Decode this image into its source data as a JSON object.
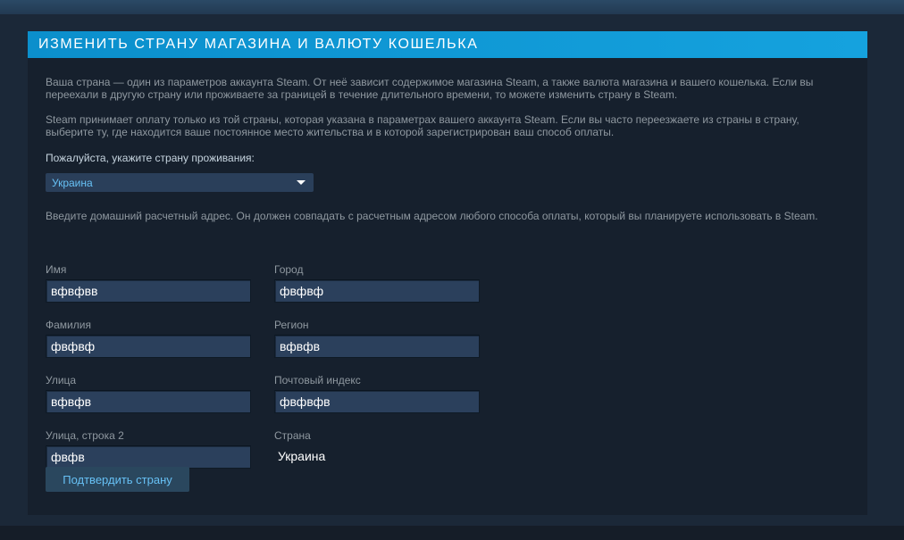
{
  "panel": {
    "title": "Изменить страну магазина и валюту кошелька",
    "intro_paragraph": "Ваша страна — один из параметров аккаунта Steam. От неё зависит содержимое магазина Steam, а также валюта магазина и вашего кошелька. Если вы переехали в другую страну или проживаете за границей в течение длительного времени, то можете изменить страну в Steam.",
    "payment_paragraph": "Steam принимает оплату только из той страны, которая указана в параметрах вашего аккаунта Steam. Если вы часто переезжаете из страны в страну, выберите ту, где находится ваше постоянное место жительства и в которой зарегистрирован ваш способ оплаты.",
    "country_prompt": "Пожалуйста, укажите страну проживания:",
    "country_select_value": "Украина",
    "address_note": "Введите домашний расчетный адрес. Он должен совпадать с расчетным адресом любого способа оплаты, который вы планируете использовать в Steam."
  },
  "form": {
    "first_name": {
      "label": "Имя",
      "value": "вфвфвв"
    },
    "last_name": {
      "label": "Фамилия",
      "value": "фвфвф"
    },
    "street": {
      "label": "Улица",
      "value": "вфвфв"
    },
    "street2": {
      "label": "Улица, строка 2",
      "value": "фвфв"
    },
    "city": {
      "label": "Город",
      "value": "фвфвф"
    },
    "region": {
      "label": "Регион",
      "value": "вфвфв"
    },
    "postal_code": {
      "label": "Почтовый индекс",
      "value": "фвфвфв"
    },
    "country": {
      "label": "Страна",
      "value": "Украина"
    }
  },
  "actions": {
    "confirm_label": "Подтвердить страну"
  },
  "colors": {
    "header_accent": "#0d9bd3",
    "link_blue": "#67c1f5",
    "background": "#1b2838",
    "panel": "#16202d",
    "input_bg": "#2b405c",
    "button_bg": "#2a475e"
  },
  "icons": {
    "select_caret": "chevron-down-icon"
  }
}
